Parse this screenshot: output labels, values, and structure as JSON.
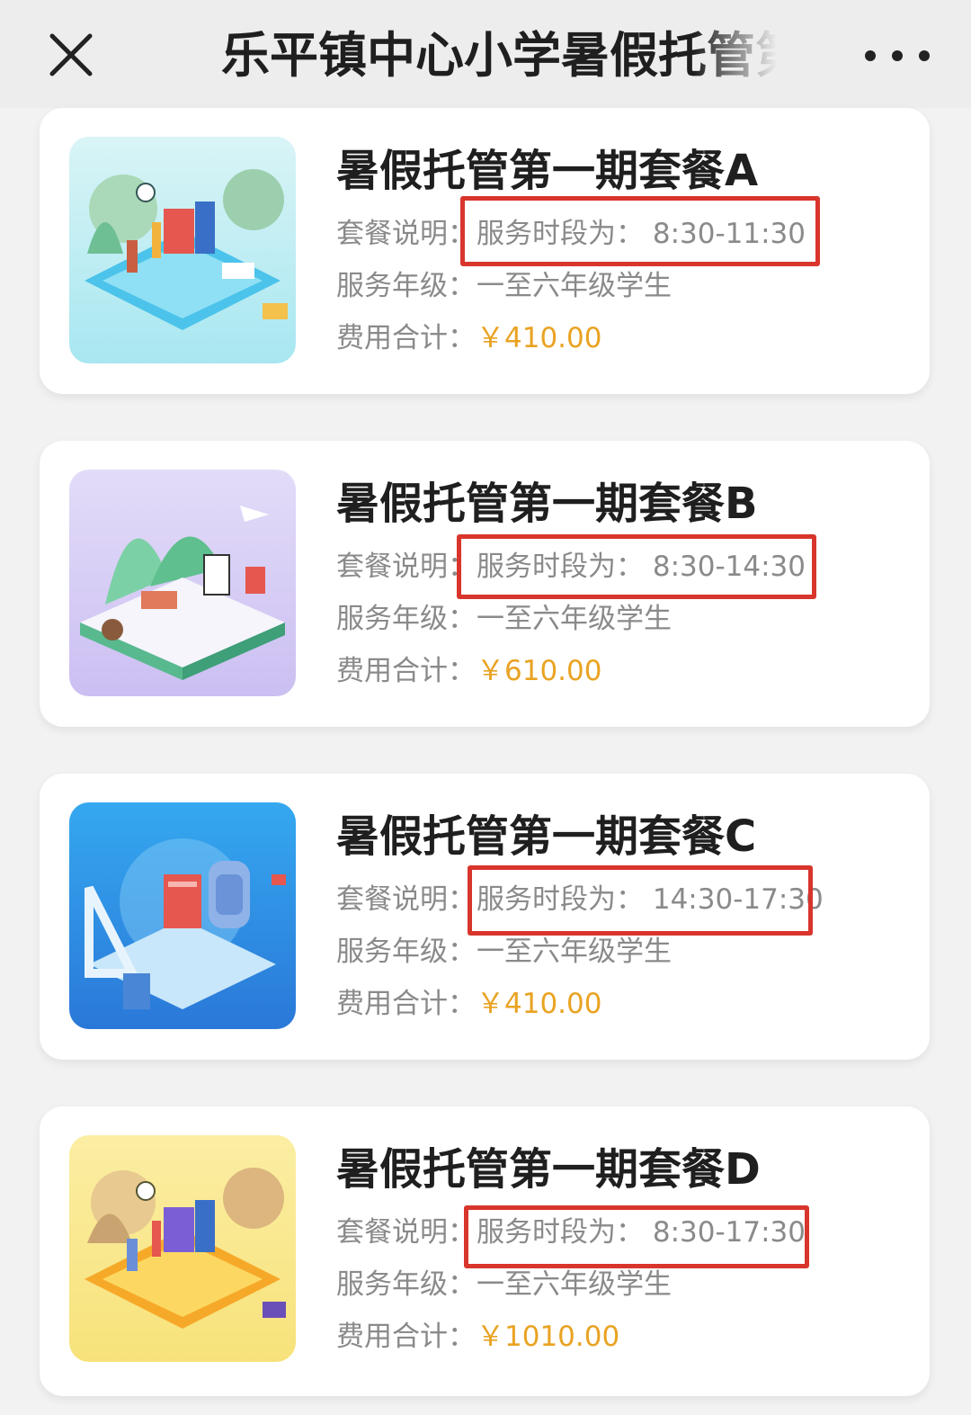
{
  "header": {
    "title": "乐平镇中心小学暑假托管第"
  },
  "packages": [
    {
      "title": "暑假托管第一期套餐A",
      "desc_label": "套餐说明：",
      "desc_value": "服务时段为：  8:30-11:30",
      "grade_label": "服务年级：",
      "grade_value": "一至六年级学生",
      "fee_label": "费用合计：",
      "fee_value": "￥410.00"
    },
    {
      "title": "暑假托管第一期套餐B",
      "desc_label": "套餐说明：",
      "desc_value": "服务时段为：  8:30-14:30",
      "grade_label": "服务年级：",
      "grade_value": "一至六年级学生",
      "fee_label": "费用合计：",
      "fee_value": "￥610.00"
    },
    {
      "title": "暑假托管第一期套餐C",
      "desc_label": "套餐说明：",
      "desc_value": "服务时段为：  14:30-17:30",
      "grade_label": "服务年级：",
      "grade_value": "一至六年级学生",
      "fee_label": "费用合计：",
      "fee_value": "￥410.00"
    },
    {
      "title": "暑假托管第一期套餐D",
      "desc_label": "套餐说明：",
      "desc_value": "服务时段为：  8:30-17:30",
      "grade_label": "服务年级：",
      "grade_value": "一至六年级学生",
      "fee_label": "费用合计：",
      "fee_value": "￥1010.00"
    }
  ],
  "colors": {
    "price": "#e9a323",
    "highlight_box": "#d8352c",
    "title_text": "#1f1f1f",
    "muted_text": "#8a8a8a"
  },
  "icons": [
    "close-icon",
    "more-icon"
  ]
}
